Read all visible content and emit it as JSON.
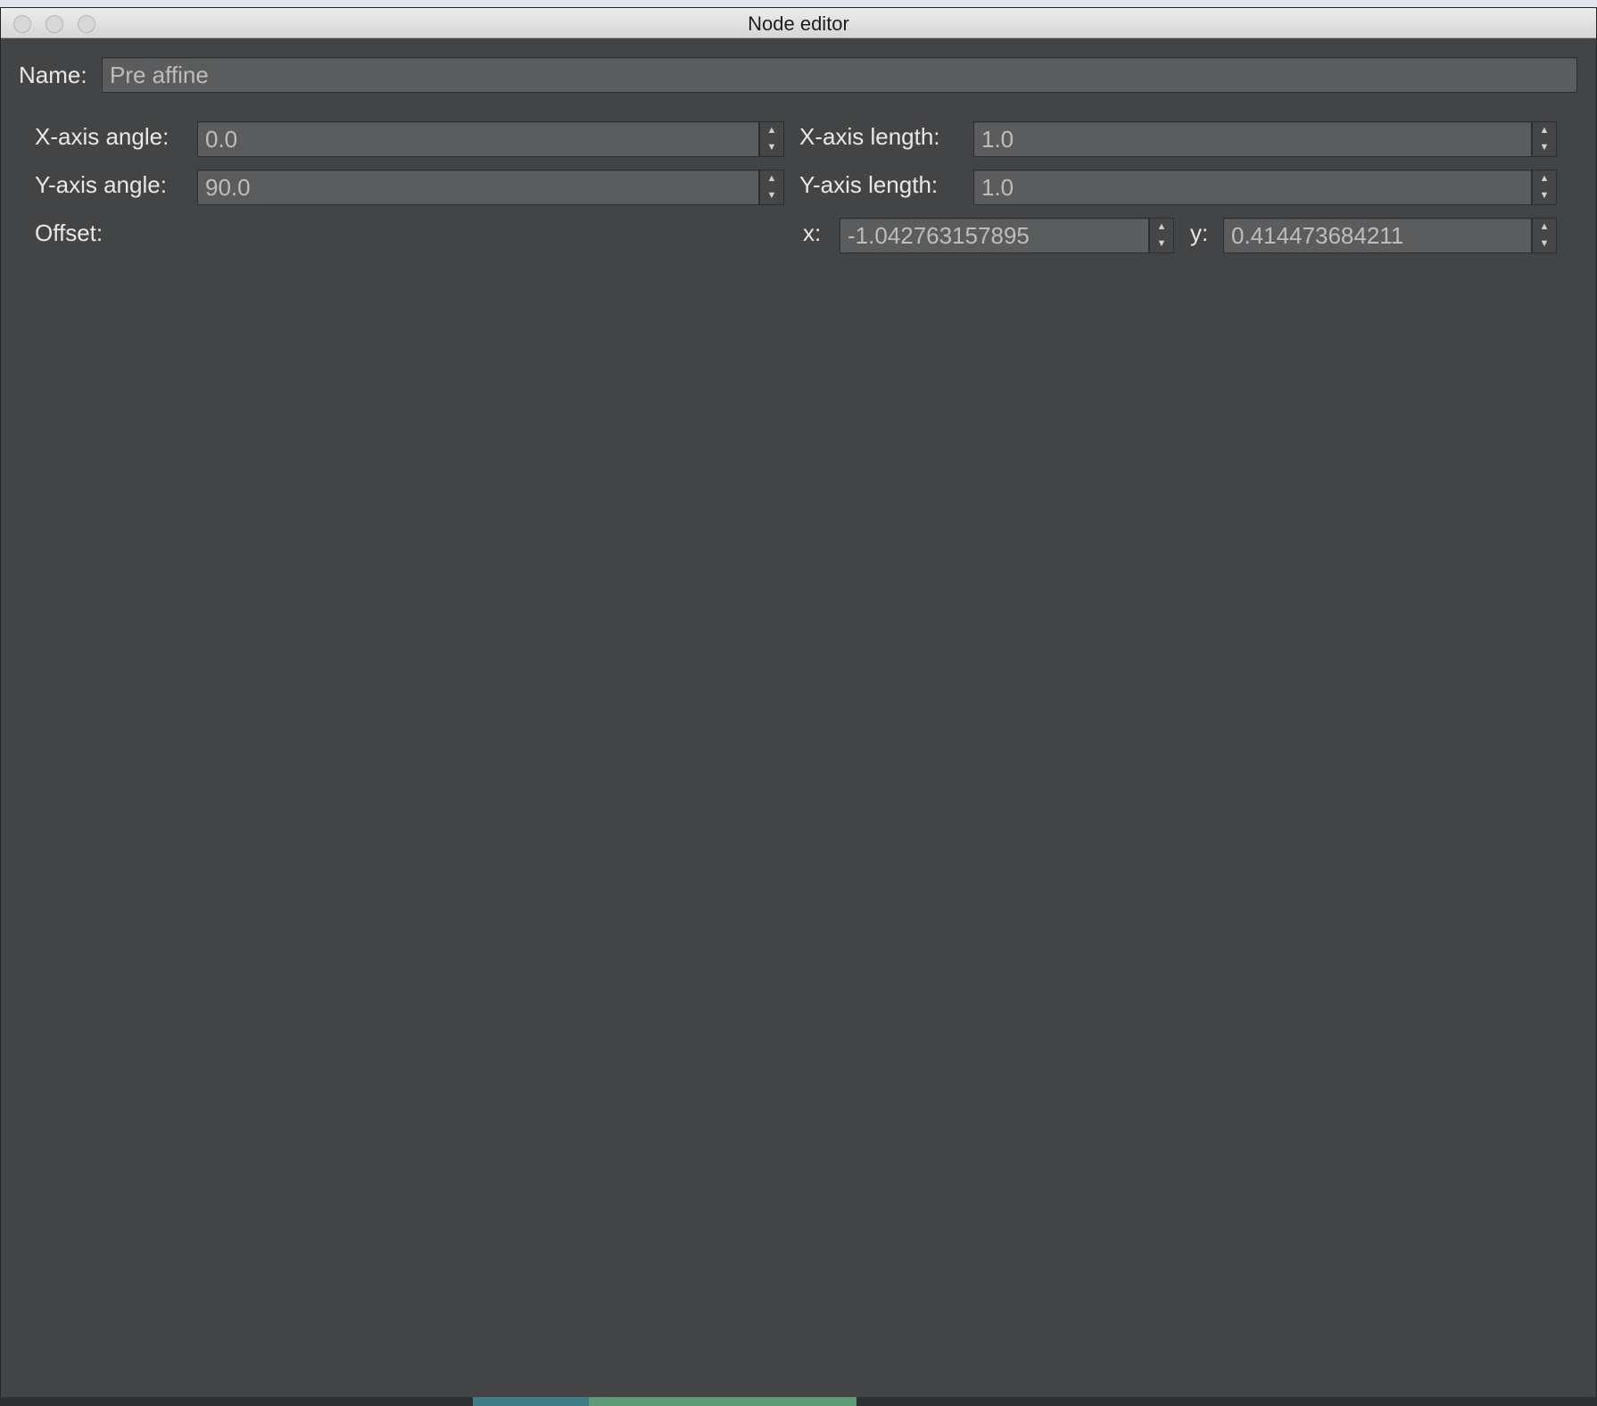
{
  "window": {
    "title": "Node editor"
  },
  "name_row": {
    "label": "Name:",
    "value": "Pre affine"
  },
  "x_axis_angle": {
    "label": "X-axis angle:",
    "value": "0.0"
  },
  "x_axis_length": {
    "label": "X-axis length:",
    "value": "1.0"
  },
  "y_axis_angle": {
    "label": "Y-axis angle:",
    "value": "90.0"
  },
  "y_axis_length": {
    "label": "Y-axis length:",
    "value": "1.0"
  },
  "offset": {
    "label": "Offset:",
    "x_label": "x:",
    "x_value": "-1.042763157895",
    "y_label": "y:",
    "y_value": "0.414473684211"
  },
  "icons": {
    "spin_up": "▲",
    "spin_down": "▼"
  },
  "colors": {
    "window_background": "#434446",
    "field_background": "#5b5c5e",
    "label_text": "#e8e8e8",
    "field_text": "#bdbdbd"
  }
}
